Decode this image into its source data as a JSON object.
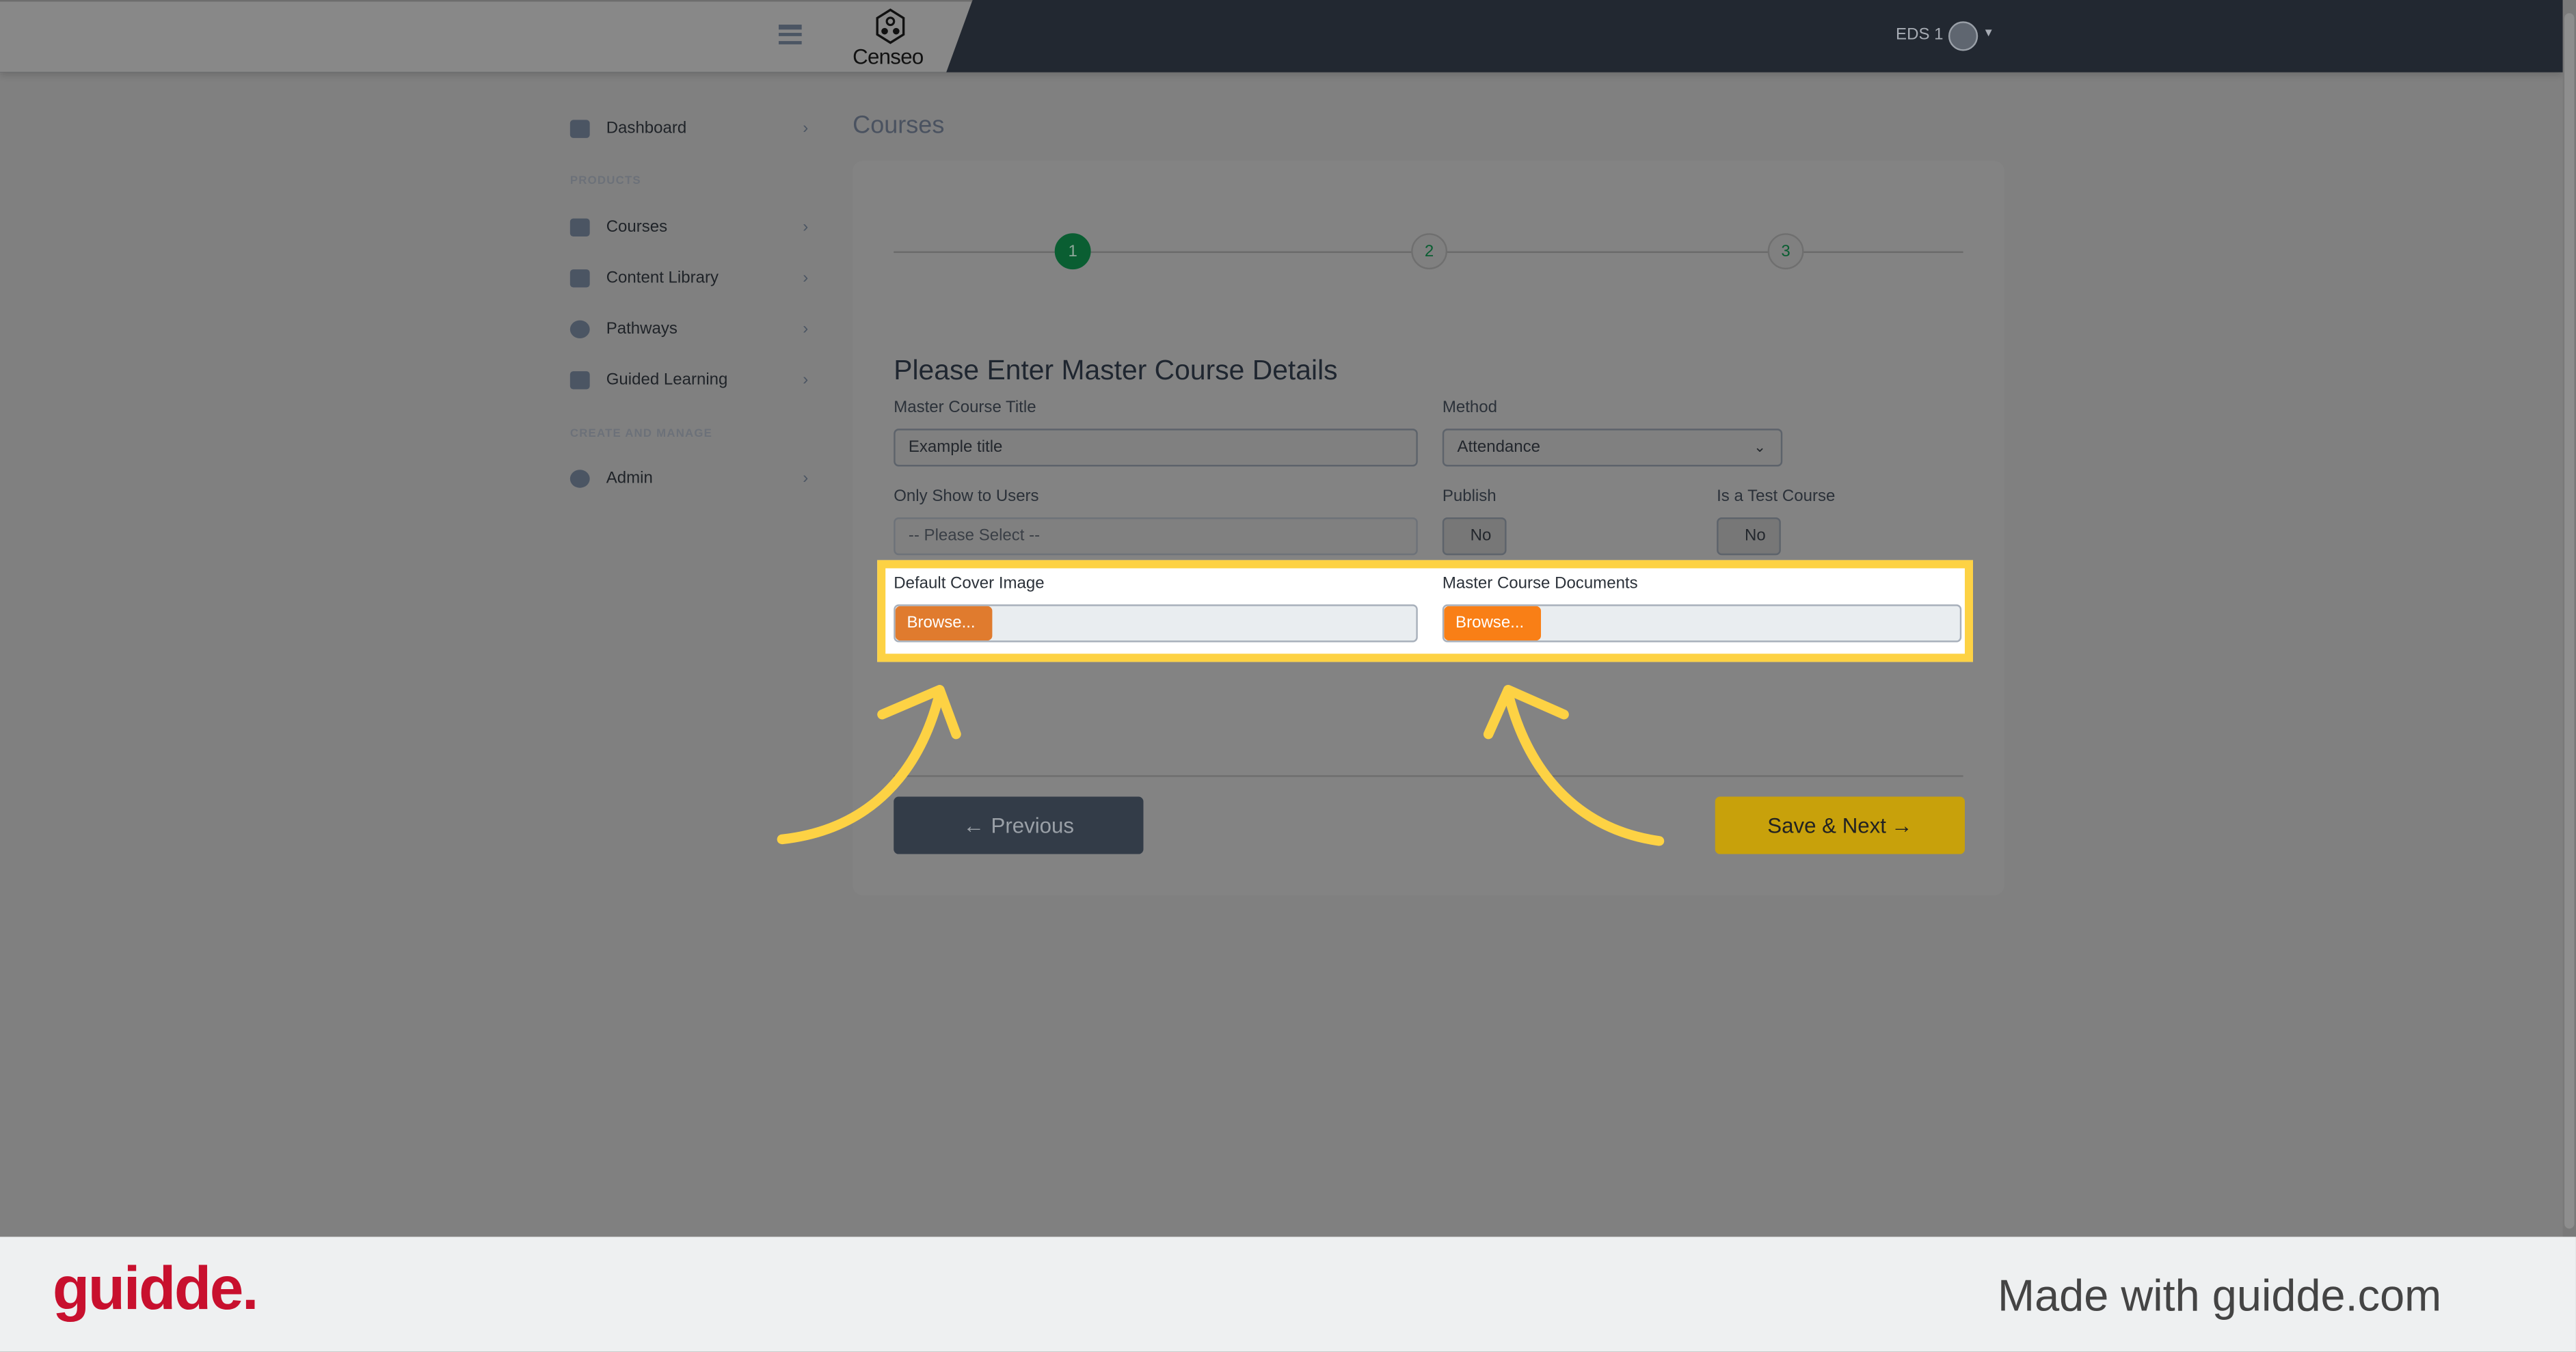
{
  "topbar": {
    "menu_icon": "hamburger-icon",
    "logo_text": "Censeo",
    "user_label": "EDS 1",
    "avatar_icon": "user-circle-icon",
    "caret_icon": "caret-down-icon"
  },
  "sidebar": {
    "items": [
      {
        "label": "Dashboard",
        "icon": "dashboard-icon"
      },
      {
        "label": "Courses",
        "icon": "courses-icon"
      },
      {
        "label": "Content Library",
        "icon": "book-icon"
      },
      {
        "label": "Pathways",
        "icon": "award-icon"
      },
      {
        "label": "Guided Learning",
        "icon": "clipboard-icon"
      },
      {
        "label": "Admin",
        "icon": "gear-icon"
      }
    ],
    "sections": [
      "PRODUCTS",
      "CREATE AND MANAGE"
    ]
  },
  "page": {
    "title": "Courses"
  },
  "stepper": {
    "steps": [
      "1",
      "2",
      "3"
    ],
    "active_step": 1
  },
  "form": {
    "heading": "Please Enter Master Course Details",
    "title_label": "Master Course Title",
    "title_value": "Example title",
    "method_label": "Method",
    "method_value": "Attendance",
    "users_label": "Only Show to Users",
    "users_placeholder": "-- Please Select --",
    "publish_label": "Publish",
    "publish_value": "No",
    "test_label": "Is a Test Course",
    "test_value": "No",
    "cover_label": "Default Cover Image",
    "documents_label": "Master Course Documents",
    "browse_label": "Browse..."
  },
  "buttons": {
    "previous": "Previous",
    "save_next": "Save & Next"
  },
  "footer": {
    "brand": "guidde.",
    "made_with": "Made with guidde.com"
  },
  "colors": {
    "highlight": "#fdd244",
    "browse": "#f97f16",
    "active_step": "#0a5e32",
    "save": "#c8a10b"
  }
}
